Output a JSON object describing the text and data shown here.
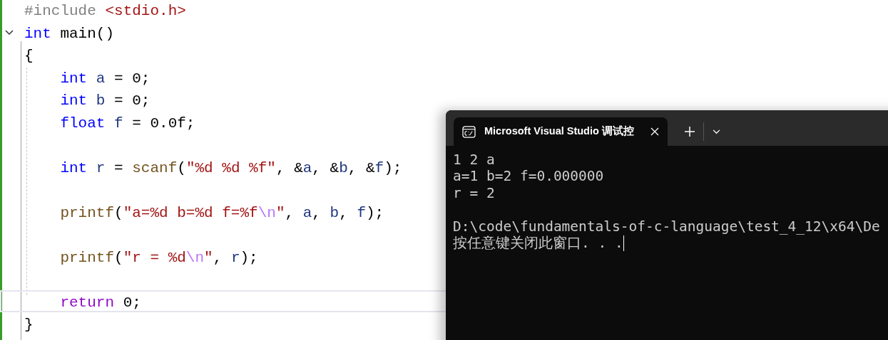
{
  "editor": {
    "lines": [
      {
        "kind": "code",
        "current": false,
        "tokens": [
          {
            "t": "#include ",
            "color": "#808080"
          },
          {
            "t": "<stdio.h>",
            "color": "#a31515"
          }
        ]
      },
      {
        "kind": "code",
        "current": false,
        "expanded": true,
        "tokens": [
          {
            "t": "int",
            "color": "#0000ff"
          },
          {
            "t": " main()",
            "color": "#000000"
          }
        ]
      },
      {
        "kind": "code",
        "current": false,
        "tokens": [
          {
            "t": "{",
            "color": "#000000"
          }
        ]
      },
      {
        "kind": "code",
        "current": false,
        "tokens": [
          {
            "t": "    int",
            "color": "#0000ff"
          },
          {
            "t": " a",
            "color": "#1f377f"
          },
          {
            "t": " = 0;",
            "color": "#000000"
          }
        ]
      },
      {
        "kind": "code",
        "current": false,
        "tokens": [
          {
            "t": "    int",
            "color": "#0000ff"
          },
          {
            "t": " b",
            "color": "#1f377f"
          },
          {
            "t": " = 0;",
            "color": "#000000"
          }
        ]
      },
      {
        "kind": "code",
        "current": false,
        "tokens": [
          {
            "t": "    float",
            "color": "#0000ff"
          },
          {
            "t": " f",
            "color": "#1f377f"
          },
          {
            "t": " = 0.0f;",
            "color": "#000000"
          }
        ]
      },
      {
        "kind": "blank",
        "current": false
      },
      {
        "kind": "code",
        "current": false,
        "tokens": [
          {
            "t": "    int",
            "color": "#0000ff"
          },
          {
            "t": " r",
            "color": "#1f377f"
          },
          {
            "t": " =",
            "color": "#000000"
          },
          {
            "t": " scanf",
            "color": "#74531f"
          },
          {
            "t": "(",
            "color": "#000000"
          },
          {
            "t": "\"%d %d %f\"",
            "color": "#a31515"
          },
          {
            "t": ", &",
            "color": "#000000"
          },
          {
            "t": "a",
            "color": "#1f377f"
          },
          {
            "t": ", &",
            "color": "#000000"
          },
          {
            "t": "b",
            "color": "#1f377f"
          },
          {
            "t": ", &",
            "color": "#000000"
          },
          {
            "t": "f",
            "color": "#1f377f"
          },
          {
            "t": ");",
            "color": "#000000"
          }
        ]
      },
      {
        "kind": "blank",
        "current": false
      },
      {
        "kind": "code",
        "current": false,
        "tokens": [
          {
            "t": "    printf",
            "color": "#74531f"
          },
          {
            "t": "(",
            "color": "#000000"
          },
          {
            "t": "\"a=%d b=%d f=%f",
            "color": "#a31515"
          },
          {
            "t": "\\n",
            "color": "#b776fb"
          },
          {
            "t": "\"",
            "color": "#a31515"
          },
          {
            "t": ", ",
            "color": "#000000"
          },
          {
            "t": "a",
            "color": "#1f377f"
          },
          {
            "t": ", ",
            "color": "#000000"
          },
          {
            "t": "b",
            "color": "#1f377f"
          },
          {
            "t": ", ",
            "color": "#000000"
          },
          {
            "t": "f",
            "color": "#1f377f"
          },
          {
            "t": ");",
            "color": "#000000"
          }
        ]
      },
      {
        "kind": "blank",
        "current": false
      },
      {
        "kind": "code",
        "current": false,
        "tokens": [
          {
            "t": "    printf",
            "color": "#74531f"
          },
          {
            "t": "(",
            "color": "#000000"
          },
          {
            "t": "\"r = %d",
            "color": "#a31515"
          },
          {
            "t": "\\n",
            "color": "#b776fb"
          },
          {
            "t": "\"",
            "color": "#a31515"
          },
          {
            "t": ", ",
            "color": "#000000"
          },
          {
            "t": "r",
            "color": "#1f377f"
          },
          {
            "t": ");",
            "color": "#000000"
          }
        ]
      },
      {
        "kind": "blank",
        "current": false
      },
      {
        "kind": "code",
        "current": true,
        "tokens": [
          {
            "t": "    return",
            "color": "#8f08c4"
          },
          {
            "t": " 0;",
            "color": "#000000"
          }
        ]
      },
      {
        "kind": "code",
        "current": false,
        "tokens": [
          {
            "t": "}",
            "color": "#000000"
          }
        ]
      }
    ]
  },
  "terminal": {
    "tab": {
      "title": "Microsoft Visual Studio 调试控",
      "selected": true
    },
    "lines": [
      {
        "kind": "text",
        "text": "1 2 a",
        "cursor": false
      },
      {
        "kind": "text",
        "text": "a=1 b=2 f=0.000000",
        "cursor": false
      },
      {
        "kind": "text",
        "text": "r = 2",
        "cursor": false
      },
      {
        "kind": "blank",
        "cursor": false
      },
      {
        "kind": "text",
        "text": "D:\\code\\fundamentals-of-c-language\\test_4_12\\x64\\De",
        "cursor": false
      },
      {
        "kind": "text",
        "text": "按任意键关闭此窗口. . .",
        "cursor": true
      }
    ]
  }
}
